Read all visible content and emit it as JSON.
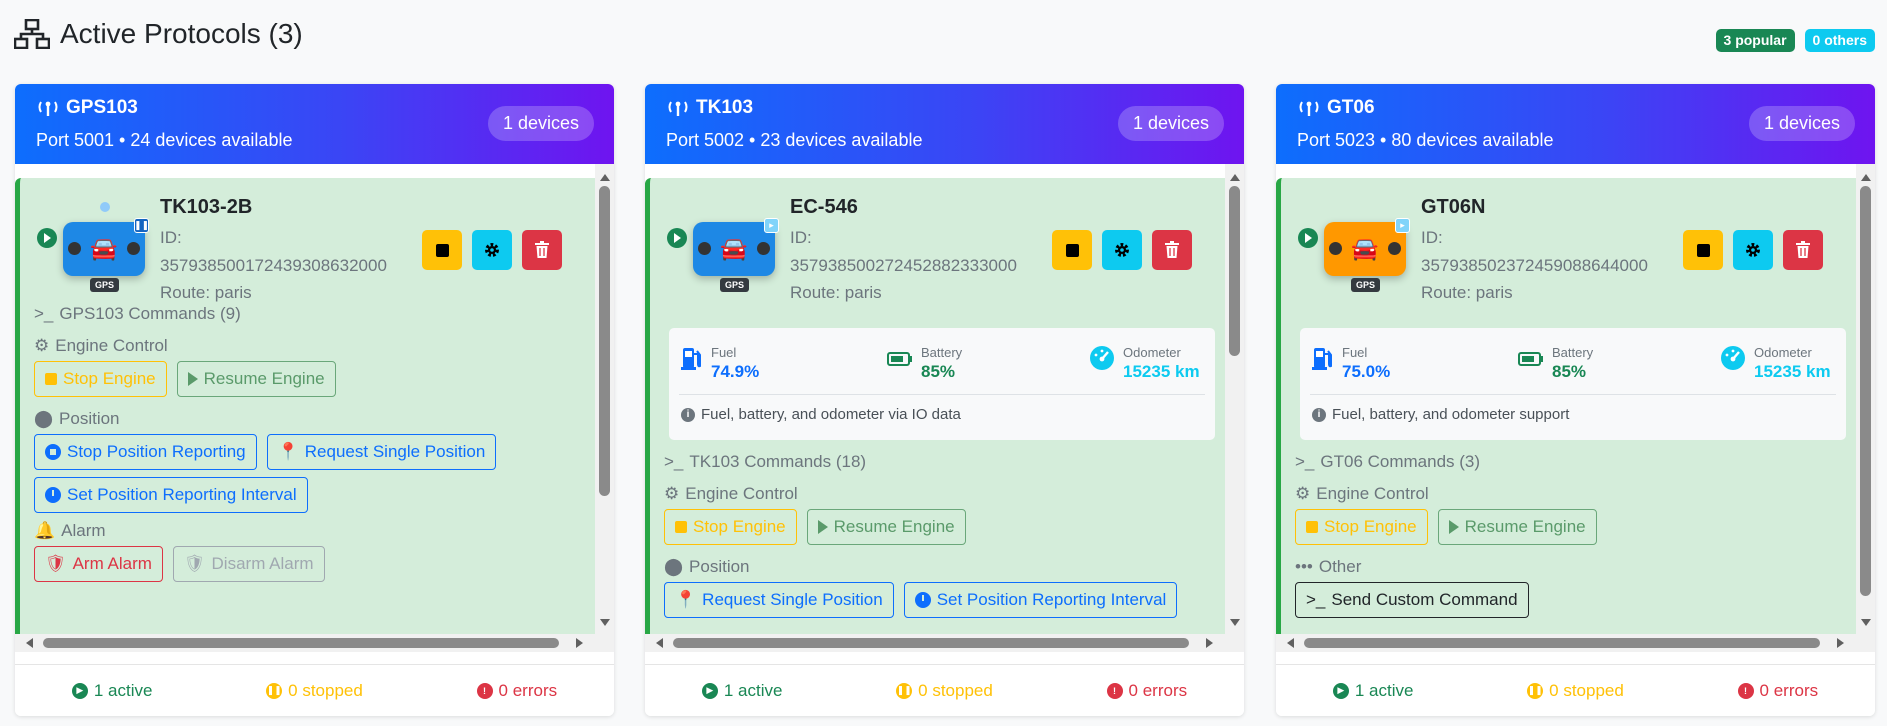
{
  "page": {
    "title": "Active Protocols (3)",
    "badge_popular": "3 popular",
    "badge_others": "0 others"
  },
  "colors": {
    "primary": "#0d6efd",
    "success": "#198754",
    "warning": "#ffc107",
    "danger": "#dc3545",
    "info": "#0dcaf0",
    "device_bg": "#d4edda"
  },
  "protocols": [
    {
      "name": "GPS103",
      "subtitle": "Port 5001 • 24 devices available",
      "devices_badge": "1 devices",
      "device": {
        "name": "TK103-2B",
        "id_label": "ID:",
        "id_value": "35793850017243930863200​0",
        "route": "Route: paris",
        "icon": "car-blue-paused",
        "gps_tag": "GPS"
      },
      "commands_header": "GPS103 Commands (9)",
      "sections": {
        "engine": {
          "label": "Engine Control",
          "stop": "Stop Engine",
          "resume": "Resume Engine"
        },
        "position": {
          "label": "Position",
          "stop_reporting": "Stop Position Reporting",
          "request_single": "Request Single Position",
          "set_interval": "Set Position Reporting Interval"
        },
        "alarm": {
          "label": "Alarm",
          "arm": "Arm Alarm",
          "disarm": "Disarm Alarm"
        }
      },
      "footer": {
        "active": "1 active",
        "stopped": "0 stopped",
        "errors": "0 errors"
      }
    },
    {
      "name": "TK103",
      "subtitle": "Port 5002 • 23 devices available",
      "devices_badge": "1 devices",
      "device": {
        "name": "EC-546",
        "id_label": "ID:",
        "id_value": "357938500272452882333000",
        "route": "Route: paris",
        "icon": "car-blue",
        "gps_tag": "GPS"
      },
      "telemetry": {
        "fuel_label": "Fuel",
        "fuel_value": "74.9%",
        "battery_label": "Battery",
        "battery_value": "85%",
        "odometer_label": "Odometer",
        "odometer_value": "15235 km",
        "note": "Fuel, battery, and odometer via IO data"
      },
      "commands_header": "TK103 Commands (18)",
      "sections": {
        "engine": {
          "label": "Engine Control",
          "stop": "Stop Engine",
          "resume": "Resume Engine"
        },
        "position": {
          "label": "Position",
          "request_single": "Request Single Position",
          "set_interval": "Set Position Reporting Interval"
        }
      },
      "footer": {
        "active": "1 active",
        "stopped": "0 stopped",
        "errors": "0 errors"
      }
    },
    {
      "name": "GT06",
      "subtitle": "Port 5023 • 80 devices available",
      "devices_badge": "1 devices",
      "device": {
        "name": "GT06N",
        "id_label": "ID:",
        "id_value": "357938502372459088644000",
        "route": "Route: paris",
        "icon": "car-orange",
        "gps_tag": "GPS"
      },
      "telemetry": {
        "fuel_label": "Fuel",
        "fuel_value": "75.0%",
        "battery_label": "Battery",
        "battery_value": "85%",
        "odometer_label": "Odometer",
        "odometer_value": "15235 km",
        "note": "Fuel, battery, and odometer support"
      },
      "commands_header": "GT06 Commands (3)",
      "sections": {
        "engine": {
          "label": "Engine Control",
          "stop": "Stop Engine",
          "resume": "Resume Engine"
        },
        "other": {
          "label": "Other",
          "custom": "Send Custom Command"
        }
      },
      "footer": {
        "active": "1 active",
        "stopped": "0 stopped",
        "errors": "0 errors"
      }
    }
  ]
}
